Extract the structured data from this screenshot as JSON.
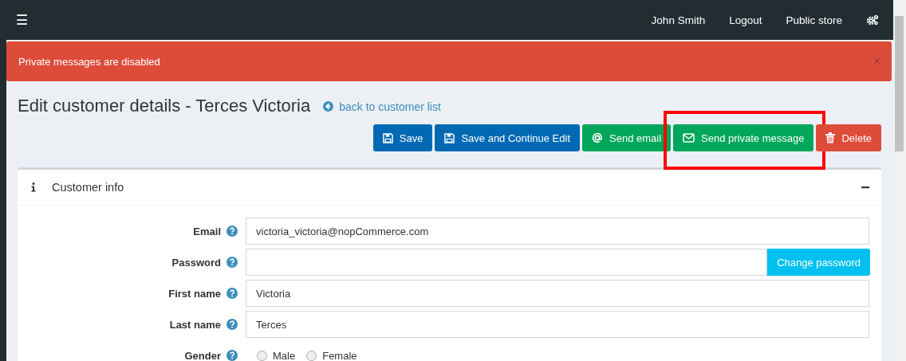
{
  "topbar": {
    "menu_icon": "☰",
    "links": [
      "John Smith",
      "Logout",
      "Public store"
    ]
  },
  "alert": {
    "message": "Private messages are disabled",
    "close": "×"
  },
  "page": {
    "title": "Edit customer details - Terces Victoria",
    "back_link": "back to customer list"
  },
  "buttons": [
    {
      "label": "Save",
      "kind": "primary",
      "highlighted": false
    },
    {
      "label": "Save and Continue Edit",
      "kind": "primary",
      "highlighted": false
    },
    {
      "label": "Send email",
      "kind": "success",
      "highlighted": false
    },
    {
      "label": "Send private message",
      "kind": "success",
      "highlighted": true
    },
    {
      "label": "Delete",
      "kind": "danger",
      "highlighted": false
    }
  ],
  "panel": {
    "title": "Customer info",
    "collapse": "−"
  },
  "fields": [
    {
      "label": "Email",
      "kind": "text",
      "value": "victoria_victoria@nopCommerce.com"
    },
    {
      "label": "Password",
      "kind": "password",
      "button": "Change password"
    },
    {
      "label": "First name",
      "kind": "text",
      "value": "Victoria"
    },
    {
      "label": "Last name",
      "kind": "text",
      "value": "Terces"
    },
    {
      "label": "Gender",
      "kind": "radio",
      "options": [
        {
          "label": "Male",
          "selected": false
        },
        {
          "label": "Female",
          "selected": false
        }
      ]
    }
  ]
}
